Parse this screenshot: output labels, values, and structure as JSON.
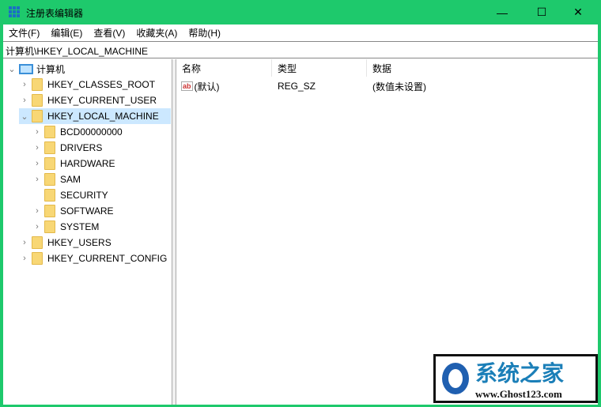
{
  "window": {
    "title": "注册表编辑器",
    "minimize": "—",
    "maximize": "☐",
    "close": "✕",
    "accent": "#1ec96c"
  },
  "menu": [
    "文件(F)",
    "编辑(E)",
    "查看(V)",
    "收藏夹(A)",
    "帮助(H)"
  ],
  "address": "计算机\\HKEY_LOCAL_MACHINE",
  "tree": {
    "root": "计算机",
    "items": [
      {
        "label": "HKEY_CLASSES_ROOT",
        "chev": "›"
      },
      {
        "label": "HKEY_CURRENT_USER",
        "chev": "›"
      },
      {
        "label": "HKEY_LOCAL_MACHINE",
        "chev": "⌄",
        "selected": true
      },
      {
        "label": "BCD00000000",
        "chev": "›"
      },
      {
        "label": "DRIVERS",
        "chev": "›"
      },
      {
        "label": "HARDWARE",
        "chev": "›"
      },
      {
        "label": "SAM",
        "chev": "›"
      },
      {
        "label": "SECURITY",
        "chev": ""
      },
      {
        "label": "SOFTWARE",
        "chev": "›"
      },
      {
        "label": "SYSTEM",
        "chev": "›"
      },
      {
        "label": "HKEY_USERS",
        "chev": "›"
      },
      {
        "label": "HKEY_CURRENT_CONFIG",
        "chev": "›"
      }
    ]
  },
  "list": {
    "columns": [
      "名称",
      "类型",
      "数据"
    ],
    "rows": [
      {
        "icon": "ab",
        "name": "(默认)",
        "type": "REG_SZ",
        "data": "(数值未设置)"
      }
    ]
  },
  "watermark": {
    "title": "系统之家",
    "url": "www.Ghost123.com"
  }
}
